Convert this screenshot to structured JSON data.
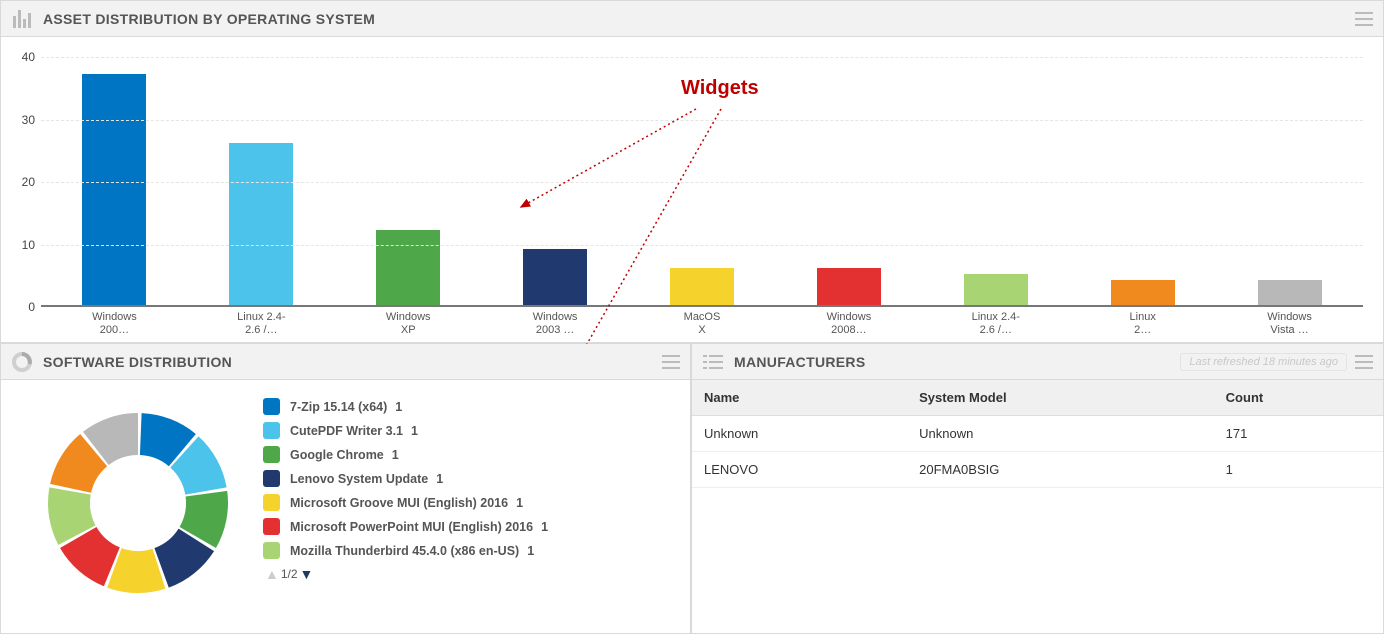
{
  "annotation": {
    "label": "Widgets"
  },
  "colors": {
    "c0": "#0075c4",
    "c1": "#4cc3eb",
    "c2": "#4ea849",
    "c3": "#203a70",
    "c4": "#f6d22c",
    "c5": "#e33030",
    "c6": "#a8d473",
    "c7": "#f08a1f",
    "c8": "#b8b8b8"
  },
  "os_widget": {
    "title": "ASSET DISTRIBUTION BY OPERATING SYSTEM"
  },
  "soft_widget": {
    "title": "SOFTWARE DISTRIBUTION",
    "pager": "1/2",
    "items": [
      {
        "label": "7-Zip 15.14 (x64)",
        "count": 1,
        "colorKey": "c0"
      },
      {
        "label": "CutePDF Writer 3.1",
        "count": 1,
        "colorKey": "c1"
      },
      {
        "label": "Google Chrome",
        "count": 1,
        "colorKey": "c2"
      },
      {
        "label": "Lenovo System Update",
        "count": 1,
        "colorKey": "c3"
      },
      {
        "label": "Microsoft Groove MUI (English) 2016",
        "count": 1,
        "colorKey": "c4"
      },
      {
        "label": "Microsoft PowerPoint MUI (English) 2016",
        "count": 1,
        "colorKey": "c5"
      },
      {
        "label": "Mozilla Thunderbird 45.4.0 (x86 en-US)",
        "count": 1,
        "colorKey": "c6"
      }
    ]
  },
  "man_widget": {
    "title": "MANUFACTURERS",
    "last_refreshed": "Last refreshed 18 minutes ago",
    "cols": {
      "c0": "Name",
      "c1": "System Model",
      "c2": "Count"
    },
    "rows": [
      {
        "c0": "Unknown",
        "c1": "Unknown",
        "c2": "171"
      },
      {
        "c0": "LENOVO",
        "c1": "20FMA0BSIG",
        "c2": "1"
      }
    ]
  },
  "chart_data": {
    "type": "bar",
    "title": "ASSET DISTRIBUTION BY OPERATING SYSTEM",
    "xlabel": "",
    "ylabel": "",
    "ylim": [
      0,
      40
    ],
    "yticks": [
      0,
      10,
      20,
      30,
      40
    ],
    "categories": [
      "Windows 200…",
      "Linux 2.4-2.6 /…",
      "Windows XP",
      "Windows 2003 …",
      "MacOS X",
      "Windows 2008…",
      "Linux 2.4-2.6 /…",
      "Linux 2…",
      "Windows Vista …"
    ],
    "categories_multiline": [
      "Windows\n200…",
      "Linux 2.4-\n2.6 /…",
      "Windows\nXP",
      "Windows\n2003 …",
      "MacOS\nX",
      "Windows\n2008…",
      "Linux 2.4-\n2.6 /…",
      "Linux\n2…",
      "Windows\nVista …"
    ],
    "values": [
      37,
      26,
      12,
      9,
      6,
      6,
      5,
      4,
      4
    ],
    "series_colors": [
      "c0",
      "c1",
      "c2",
      "c3",
      "c4",
      "c5",
      "c6",
      "c7",
      "c8"
    ]
  }
}
